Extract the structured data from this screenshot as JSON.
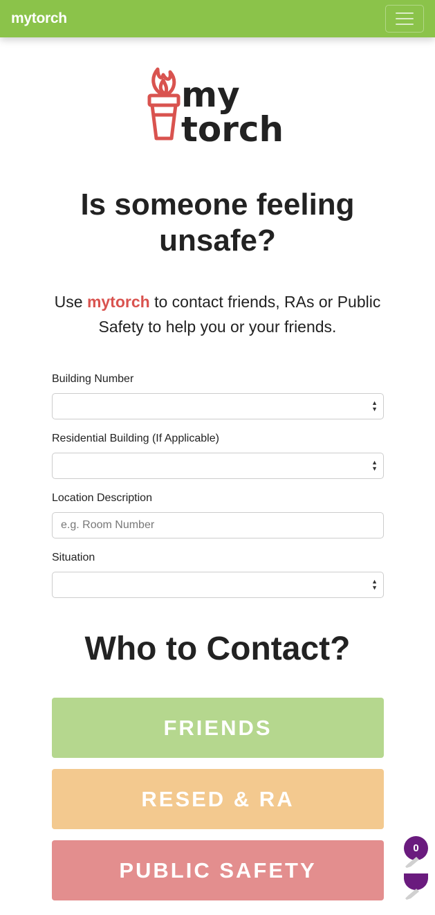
{
  "nav": {
    "brand": "mytorch"
  },
  "logo": {
    "line1": "my",
    "line2": "torch",
    "color": "#d9534f"
  },
  "hero": {
    "headline": "Is someone feeling unsafe?",
    "intro_prefix": "Use ",
    "intro_accent": "mytorch",
    "intro_suffix": " to contact friends, RAs or Public Safety to help you or your friends."
  },
  "form": {
    "building_label": "Building Number",
    "building_value": "",
    "residential_label": "Residential Building (If Applicable)",
    "residential_value": "",
    "location_label": "Location Description",
    "location_placeholder": "e.g. Room Number",
    "situation_label": "Situation",
    "situation_value": ""
  },
  "contact": {
    "title": "Who to Contact?",
    "buttons": [
      {
        "label": "FRIENDS",
        "color": "#b5d78e"
      },
      {
        "label": "RESED & RA",
        "color": "#f3c98f"
      },
      {
        "label": "PUBLIC SAFETY",
        "color": "#e38e8e"
      }
    ]
  },
  "widget": {
    "count": "0",
    "color": "#6a1b7e"
  }
}
